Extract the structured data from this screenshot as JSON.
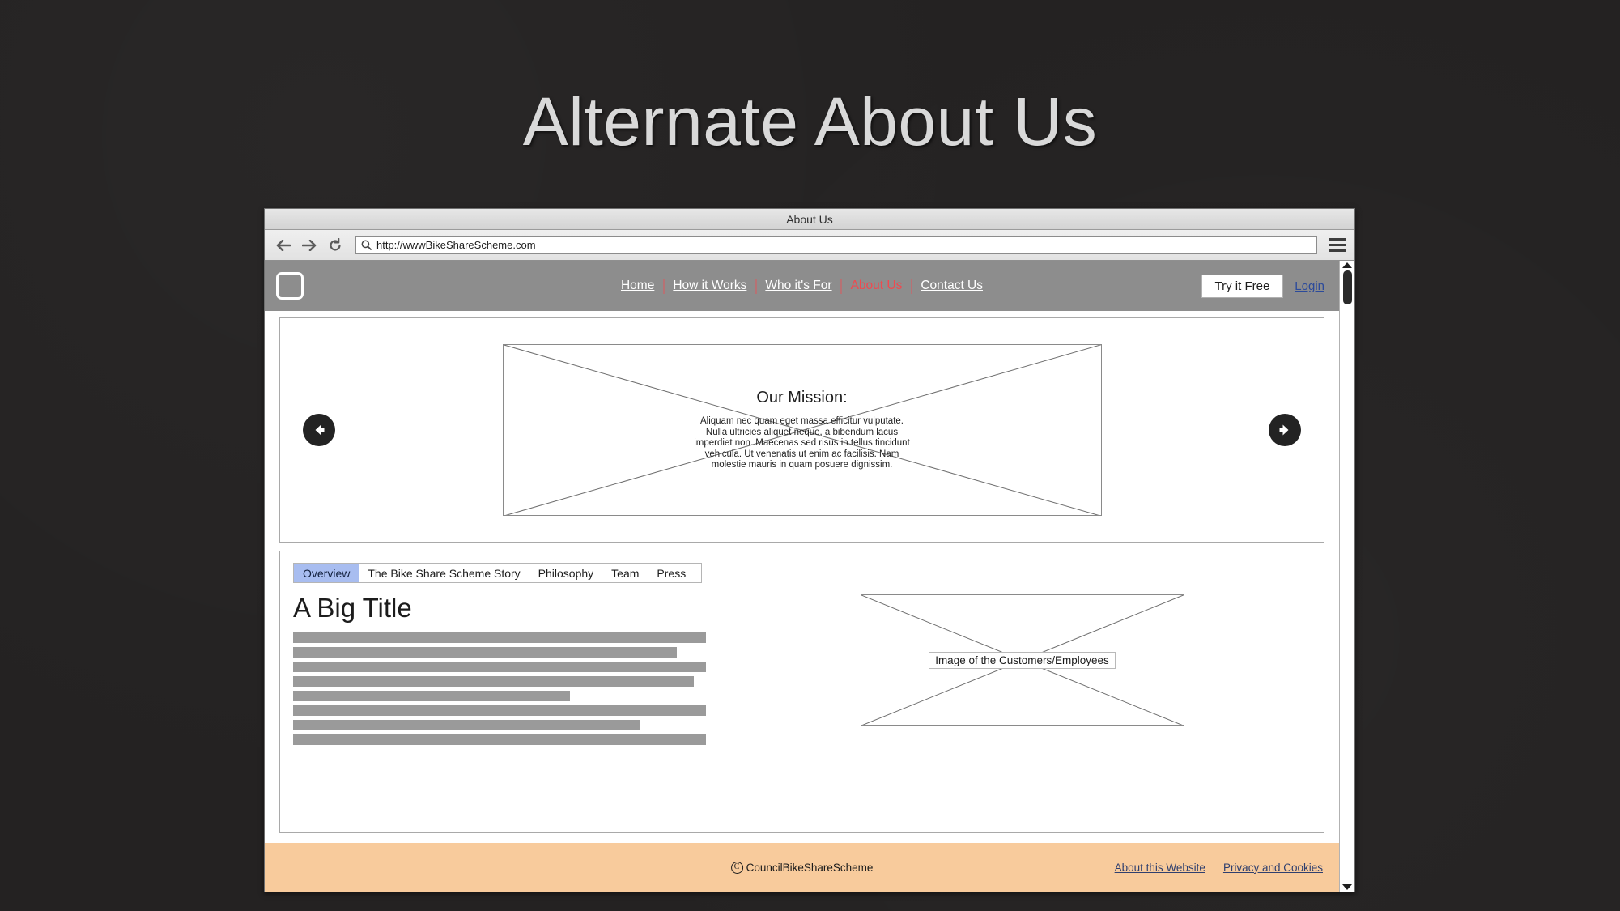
{
  "slide": {
    "title": "Alternate About Us"
  },
  "browser": {
    "window_title": "About Us",
    "url": "http://wwwBikeShareScheme.com",
    "back_icon": "back-arrow-icon",
    "forward_icon": "forward-arrow-icon",
    "reload_icon": "reload-icon",
    "search_icon": "search-icon",
    "menu_icon": "hamburger-menu-icon"
  },
  "site_header": {
    "logo": "logo-placeholder",
    "nav": [
      {
        "label": "Home",
        "active": false
      },
      {
        "label": "How it Works",
        "active": false
      },
      {
        "label": "Who it's For",
        "active": false
      },
      {
        "label": "About Us",
        "active": true
      },
      {
        "label": "Contact Us",
        "active": false
      }
    ],
    "cta_label": "Try it Free",
    "login_label": "Login",
    "bg_color": "#8d8d8d",
    "active_color": "#f0494f",
    "login_color": "#2b4a9b"
  },
  "carousel": {
    "prev_icon": "arrow-left-icon",
    "next_icon": "arrow-right-icon",
    "slide": {
      "heading": "Our Mission:",
      "body_lines": [
        "Aliquam nec quam eget massa efficitur vulputate.",
        "Nulla ultricies aliquet neque, a bibendum lacus",
        "imperdiet non. Maecenas sed risus in tellus tincidunt",
        "vehicula. Ut venenatis ut enim ac facilisis. Nam",
        "molestie mauris in quam posuere dignissim."
      ]
    }
  },
  "panel": {
    "tabs": [
      {
        "label": "Overview",
        "active": true
      },
      {
        "label": "The Bike Share Scheme Story",
        "active": false
      },
      {
        "label": "Philosophy",
        "active": false
      },
      {
        "label": "Team",
        "active": false
      },
      {
        "label": "Press",
        "active": false
      }
    ],
    "active_tab_color": "#a8bdf0",
    "content": {
      "title": "A Big Title",
      "text_bar_widths": [
        100,
        93,
        100,
        97,
        67,
        100,
        84,
        100
      ],
      "image_caption": "Image of the Customers/Employees"
    }
  },
  "footer": {
    "copyright_symbol": "C",
    "copyright_text": "CouncilBikeShareScheme",
    "links": [
      {
        "label": "About this Website"
      },
      {
        "label": "Privacy and Cookies"
      }
    ],
    "bg_color": "#f8cb9c"
  },
  "scrollbar": {
    "up_icon": "scroll-up-arrow-icon",
    "down_icon": "scroll-down-arrow-icon",
    "thumb": "scrollbar-thumb"
  }
}
